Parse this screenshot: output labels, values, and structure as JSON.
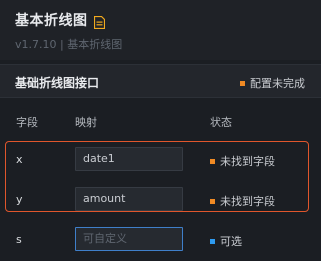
{
  "header": {
    "title": "基本折线图",
    "version": "v1.7.10 | 基本折线图"
  },
  "section": {
    "title": "基础折线图接口",
    "status": "配置未完成",
    "status_color": "#f08a24"
  },
  "columns": {
    "field": "字段",
    "mapping": "映射",
    "status": "状态"
  },
  "rows": [
    {
      "field": "x",
      "value": "date1",
      "placeholder": "",
      "status": "未找到字段",
      "status_color": "#f08a24"
    },
    {
      "field": "y",
      "value": "amount",
      "placeholder": "",
      "status": "未找到字段",
      "status_color": "#f08a24"
    },
    {
      "field": "s",
      "value": "",
      "placeholder": "可自定义",
      "status": "可选",
      "status_color": "#2e9bf0"
    }
  ],
  "colors": {
    "background": "#1b1e23",
    "highlight_border": "#e0562c",
    "doc_icon": "#f0a91e"
  },
  "icons": {
    "title_icon": "document-icon"
  }
}
